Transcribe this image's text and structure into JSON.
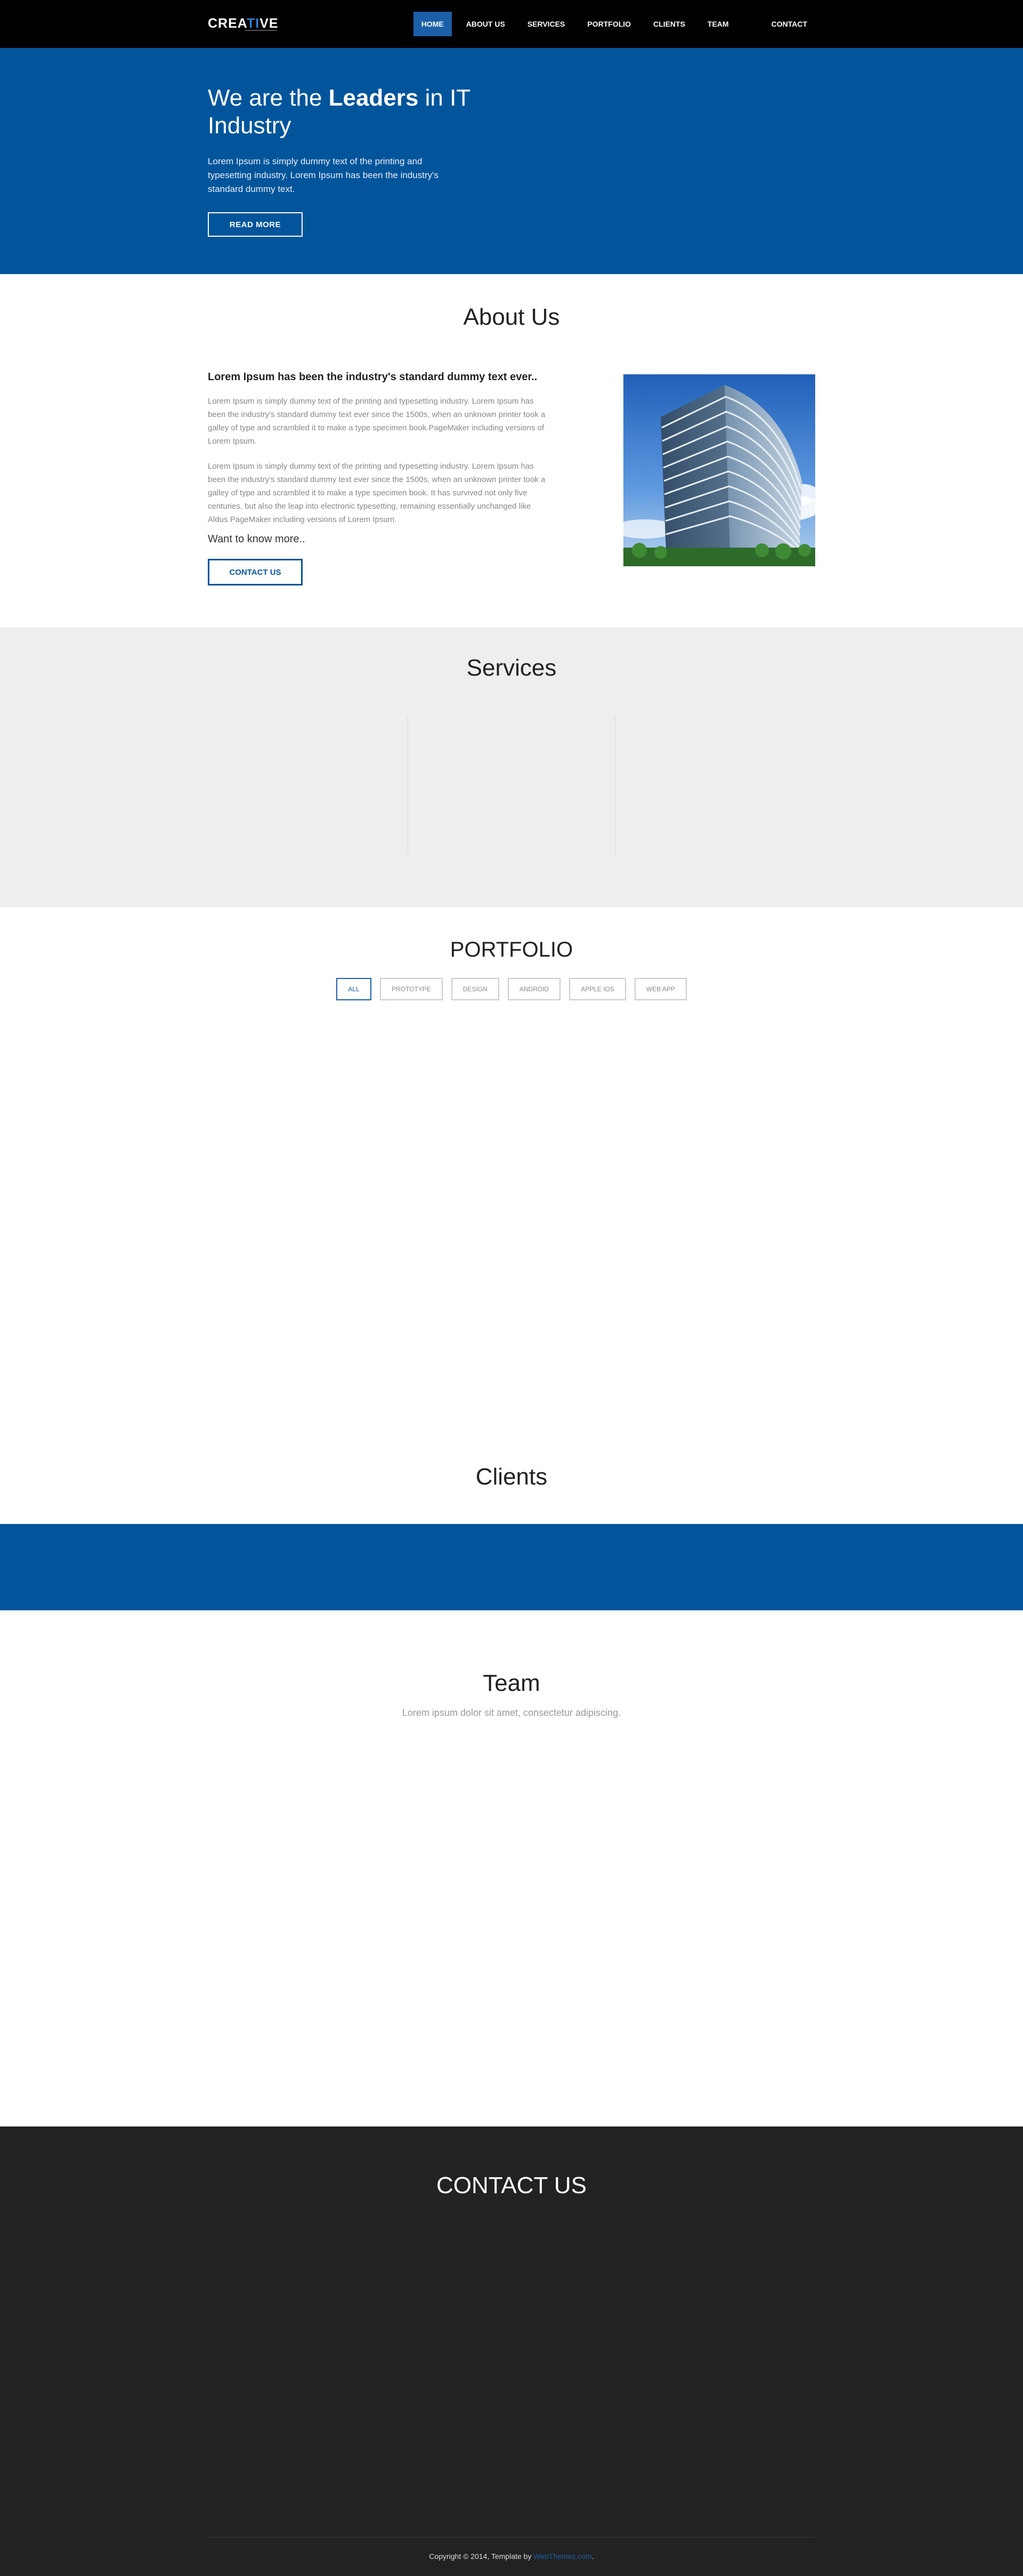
{
  "nav": {
    "logo_a": "CREA",
    "logo_b": "TI",
    "logo_c": "VE",
    "items": [
      "HOME",
      "ABOUT US",
      "SERVICES",
      "PORTFOLIO",
      "CLIENTS",
      "TEAM",
      "CONTACT"
    ],
    "active": "HOME"
  },
  "hero": {
    "title_pre": "We are the ",
    "title_bold": "Leaders",
    "title_post": " in IT Industry",
    "text": "Lorem Ipsum is simply dummy text of the printing and typesetting industry. Lorem Ipsum has been the industry's standard dummy text.",
    "button": "READ MORE"
  },
  "about": {
    "title": "About Us",
    "heading": "Lorem Ipsum has been the industry's standard dummy text ever..",
    "p1": "Lorem Ipsum is simply dummy text of the printing and typesetting industry. Lorem Ipsum has been the industry's standard dummy text ever since the 1500s, when an unknown printer took a galley of type and scrambled it to make a type specimen book.PageMaker including versions of Lorem Ipsum.",
    "p2": "Lorem Ipsum is simply dummy text of the printing and typesetting industry. Lorem Ipsum has been the industry's standard dummy text ever since the 1500s, when an unknown printer took a galley of type and scrambled it to make a type specimen book. It has survived not only five centuries, but also the leap into electronic typesetting, remaining essentially unchanged like Aldus PageMaker including versions of Lorem Ipsum.",
    "more": "Want to know more..",
    "button": "CONTACT US"
  },
  "services": {
    "title": "Services"
  },
  "portfolio": {
    "title": "PORTFOLIO",
    "filters": [
      "ALL",
      "PROTOTYPE",
      "DESIGN",
      "ANDROID",
      "APPLE IOS",
      "WEB APP"
    ],
    "active_filter": "ALL"
  },
  "clients": {
    "title": "Clients"
  },
  "team": {
    "title": "Team",
    "subtitle": "Lorem ipsum dolor sit amet, consectetur adipiscing."
  },
  "contact": {
    "title": "CONTACT US",
    "copyright_pre": "Copyright © 2014, Template by ",
    "copyright_link": "WebThemez.com",
    "copyright_post": "."
  },
  "colors": {
    "brand_blue": "#02559b",
    "nav_bg": "#000000",
    "services_bg": "#eeeeee",
    "contact_bg": "#222222"
  }
}
